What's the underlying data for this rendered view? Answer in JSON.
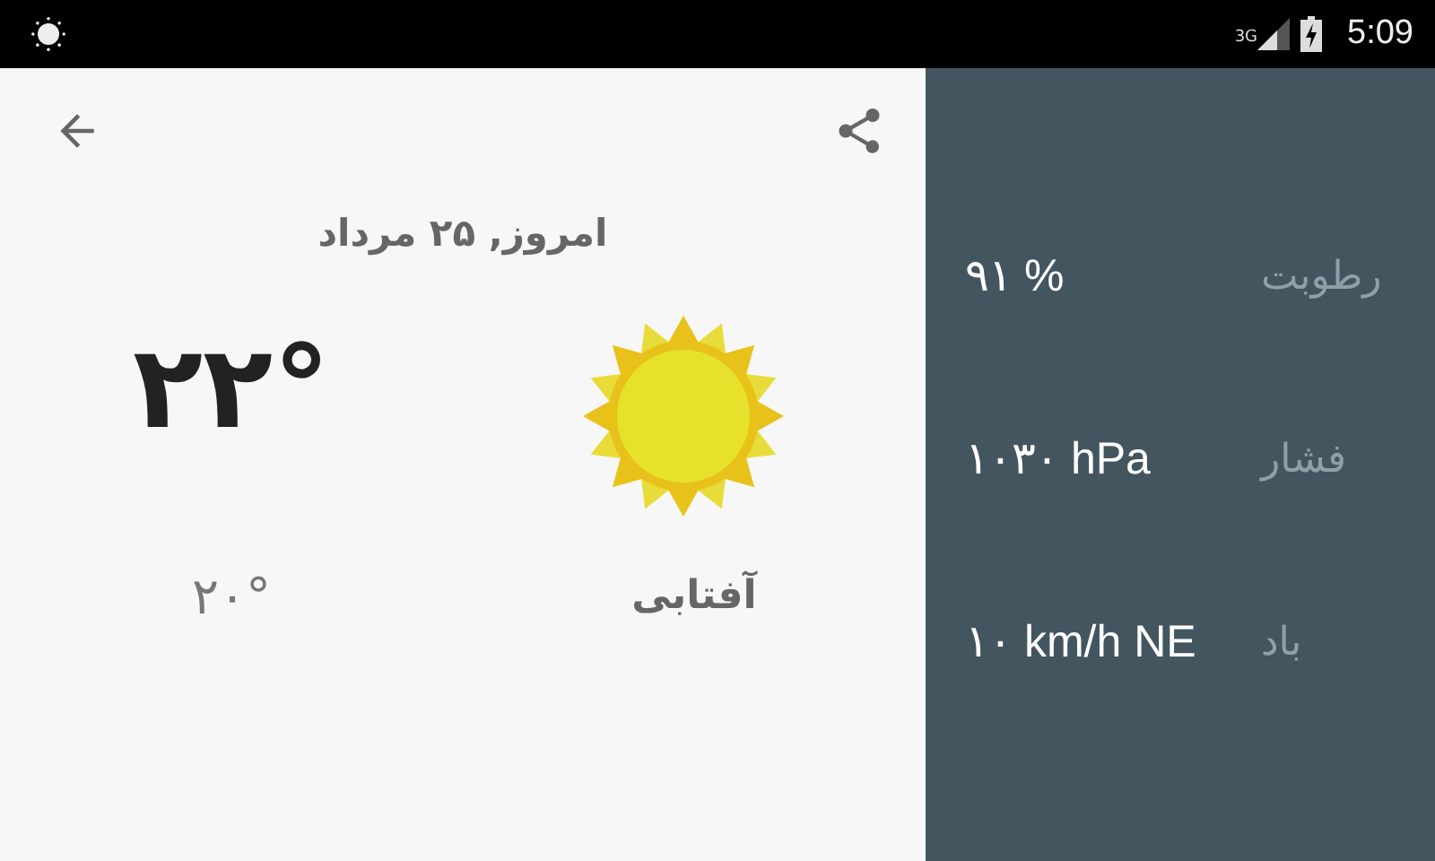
{
  "status_bar": {
    "network": "3G",
    "time": "5:09"
  },
  "date": "امروز, ۲۵ مرداد",
  "current": {
    "temperature": "۲۲°",
    "condition": "آفتابی",
    "secondary_temperature": "۲۰°"
  },
  "details": [
    {
      "label": "رطوبت",
      "value": "۹۱ %"
    },
    {
      "label": "فشار",
      "value": "۱۰۳۰ hPa"
    },
    {
      "label": "باد",
      "value": "۱۰ km/h NE"
    }
  ]
}
